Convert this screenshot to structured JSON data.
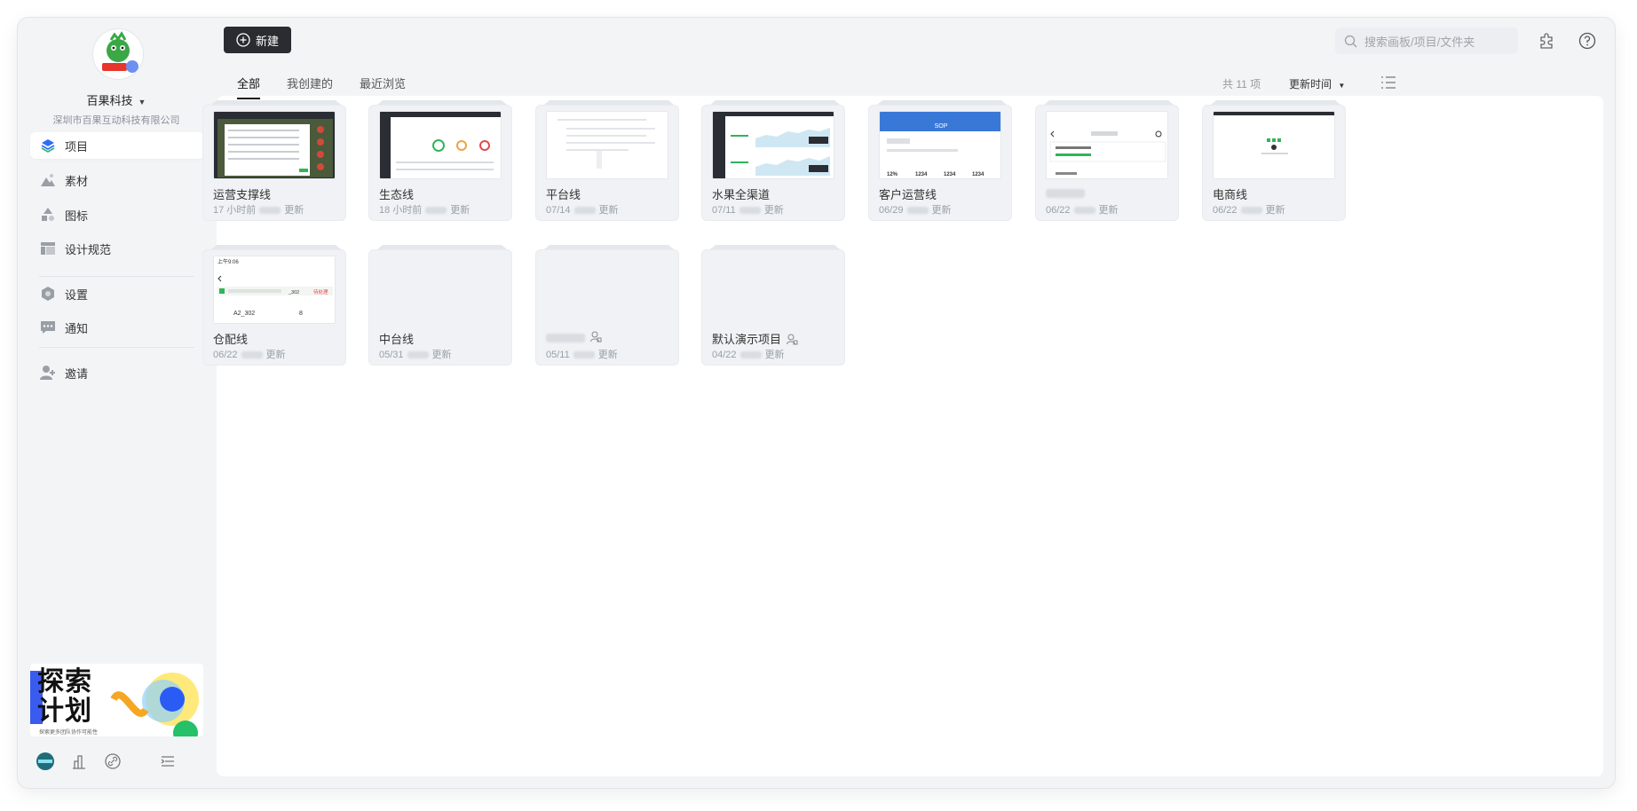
{
  "org": {
    "name": "百果科技",
    "subtitle": "深圳市百果互动科技有限公司"
  },
  "sidebar": {
    "items": [
      {
        "label": "项目",
        "icon": "layers-icon"
      },
      {
        "label": "素材",
        "icon": "image-icon"
      },
      {
        "label": "图标",
        "icon": "shapes-icon"
      },
      {
        "label": "设计规范",
        "icon": "layout-icon"
      },
      {
        "label": "设置",
        "icon": "hexagon-icon"
      },
      {
        "label": "通知",
        "icon": "message-icon"
      },
      {
        "label": "邀请",
        "icon": "add-user-icon"
      }
    ],
    "banner": {
      "title_line1": "探索",
      "title_line2": "计划",
      "caption": "探索更多团队协作可能性"
    }
  },
  "toolbar": {
    "new_label": "新建",
    "search_placeholder": "搜索画板/项目/文件夹"
  },
  "tabs": [
    "全部",
    "我创建的",
    "最近浏览"
  ],
  "count_label": "共 11 项",
  "sort_label": "更新时间",
  "update_suffix": "更新",
  "projects": [
    {
      "name": "运营支撑线",
      "time": "17 小时前"
    },
    {
      "name": "生态线",
      "time": "18 小时前"
    },
    {
      "name": "平台线",
      "time": "07/14"
    },
    {
      "name": "水果全渠道",
      "time": "07/11"
    },
    {
      "name": "客户运营线",
      "time": "06/29"
    },
    {
      "name": "",
      "time": "06/22"
    },
    {
      "name": "电商线",
      "time": "06/22"
    },
    {
      "name": "仓配线",
      "time": "06/22"
    },
    {
      "name": "中台线",
      "time": "05/31"
    },
    {
      "name": "",
      "time": "05/11"
    },
    {
      "name": "默认演示项目",
      "time": "04/22"
    }
  ],
  "thumbs": {
    "sop_title": "SOP",
    "sop_numbers": [
      "12%",
      "1234",
      "1234",
      "1234"
    ],
    "warehouse_time": "上午9:06",
    "warehouse_code": "A2_302",
    "warehouse_qty": "8",
    "warehouse_tag": "待处理",
    "warehouse_suffix": "_302"
  }
}
